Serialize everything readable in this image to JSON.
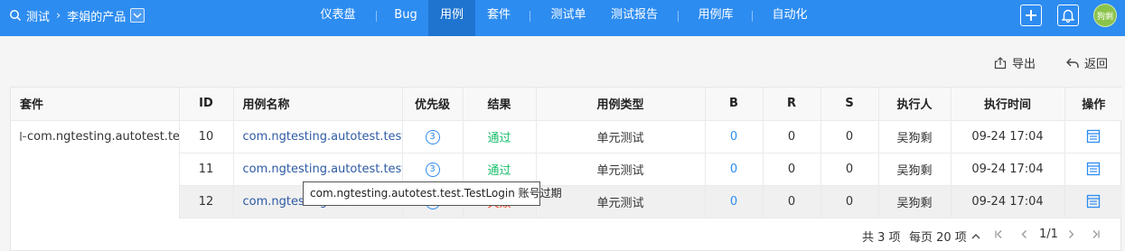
{
  "topbar": {
    "project": "测试",
    "product": "李娟的产品",
    "nav": [
      "仪表盘",
      "Bug",
      "用例",
      "套件",
      "测试单",
      "测试报告",
      "用例库",
      "自动化"
    ],
    "active_nav": "用例",
    "avatar_text": "狗剩"
  },
  "actions": {
    "export": "导出",
    "back": "返回"
  },
  "table": {
    "headers": [
      "套件",
      "ID",
      "用例名称",
      "优先级",
      "结果",
      "用例类型",
      "B",
      "R",
      "S",
      "执行人",
      "执行时间",
      "操作"
    ],
    "suite": "com.ngtesting.autotest.te",
    "rows": [
      {
        "id": "10",
        "name": "com.ngtesting.autotest.test.T",
        "priority": "3",
        "result": "通过",
        "type": "单元测试",
        "b": "0",
        "r": "0",
        "s": "0",
        "executor": "吴狗剩",
        "time": "09-24 17:04"
      },
      {
        "id": "11",
        "name": "com.ngtesting.autotest.test.T",
        "priority": "3",
        "result": "通过",
        "type": "单元测试",
        "b": "0",
        "r": "0",
        "s": "0",
        "executor": "吴狗剩",
        "time": "09-24 17:04"
      },
      {
        "id": "12",
        "name": "com.ngtesting.autotest.test.T",
        "priority": "3",
        "result": "失败",
        "type": "单元测试",
        "b": "0",
        "r": "0",
        "s": "0",
        "executor": "吴狗剩",
        "time": "09-24 17:04"
      }
    ]
  },
  "tooltip": "com.ngtesting.autotest.test.TestLogin 账号过期",
  "pager": {
    "total": "共 3 项",
    "page_size": "每页 20 项",
    "page": "1/1"
  },
  "colors": {
    "primary": "#2d8cf0",
    "pass": "#19be6b",
    "fail": "#ed3f14"
  }
}
